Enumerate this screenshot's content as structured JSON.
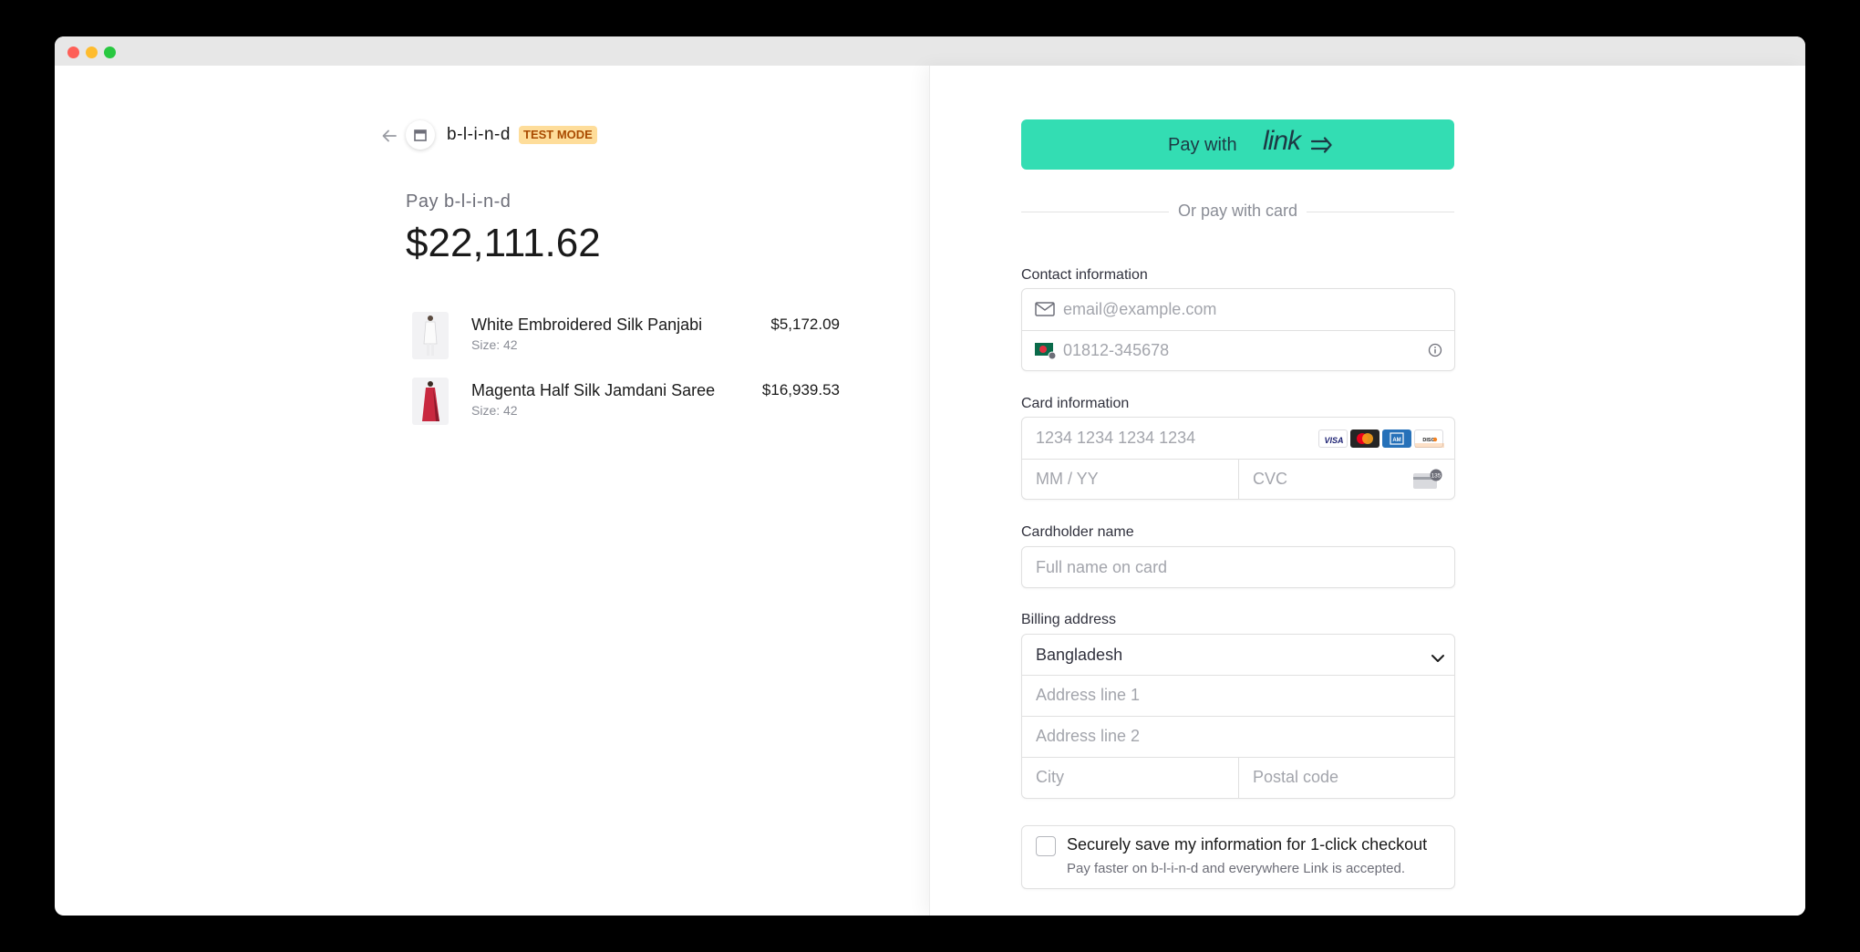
{
  "header": {
    "merchant_name": "b-l-i-n-d",
    "mode_badge": "TEST MODE"
  },
  "summary": {
    "pay_label": "Pay b-l-i-n-d",
    "amount": "$22,111.62"
  },
  "line_items": [
    {
      "name": "White Embroidered Silk Panjabi",
      "size": "Size: 42",
      "price": "$5,172.09"
    },
    {
      "name": "Magenta Half Silk Jamdani Saree",
      "size": "Size: 42",
      "price": "$16,939.53"
    }
  ],
  "link_button": {
    "prefix": "Pay with",
    "brand": "link"
  },
  "divider_text": "Or pay with card",
  "contact": {
    "label": "Contact information",
    "email_placeholder": "email@example.com",
    "phone_placeholder": "01812-345678"
  },
  "card": {
    "label": "Card information",
    "number_placeholder": "1234 1234 1234 1234",
    "expiry_placeholder": "MM / YY",
    "cvc_placeholder": "CVC",
    "brands": [
      "VISA",
      "mastercard",
      "AMEX",
      "DISCOVER"
    ],
    "cvc_hint": "135"
  },
  "cardholder": {
    "label": "Cardholder name",
    "placeholder": "Full name on card"
  },
  "billing": {
    "label": "Billing address",
    "country": "Bangladesh",
    "line1_placeholder": "Address line 1",
    "line2_placeholder": "Address line 2",
    "city_placeholder": "City",
    "postal_placeholder": "Postal code"
  },
  "save_info": {
    "title": "Securely save my information for 1-click checkout",
    "subtitle": "Pay faster on b-l-i-n-d and everywhere Link is accepted."
  },
  "colors": {
    "link_green": "#33ddb3",
    "badge_bg": "#fedd9a",
    "badge_text": "#a94a00"
  }
}
